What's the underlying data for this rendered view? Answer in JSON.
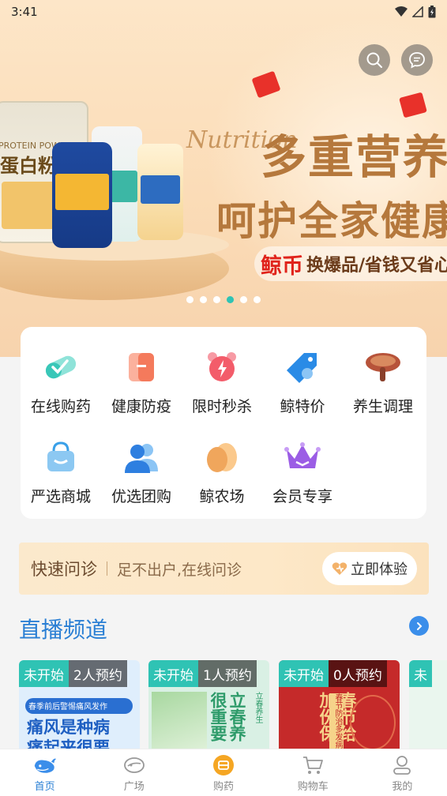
{
  "status_bar": {
    "time": "3:41"
  },
  "banner": {
    "script_text": "Nutrition",
    "headline1": "多重营养",
    "headline2": "呵护全家健康",
    "tag_coin": "鲸币",
    "tag_text": "换爆品/省钱又省心",
    "product_label": "蛋白粉",
    "product_label_small": "PROTEIN POWDER",
    "dots_total": 6,
    "dots_active_index": 3
  },
  "menu": {
    "row1": [
      {
        "label": "在线购药",
        "icon": "pill-icon",
        "color": "#39c7b8"
      },
      {
        "label": "健康防疫",
        "icon": "medical-kit-icon",
        "color": "#f47a5c"
      },
      {
        "label": "限时秒杀",
        "icon": "alarm-clock-icon",
        "color": "#f35c6a"
      },
      {
        "label": "鲸特价",
        "icon": "price-tag-icon",
        "color": "#2a8be6"
      },
      {
        "label": "养生调理",
        "icon": "lingzhi-mushroom-icon",
        "color": "#b7533a"
      }
    ],
    "row2": [
      {
        "label": "严选商城",
        "icon": "shopping-bag-icon",
        "color": "#3aa0e8"
      },
      {
        "label": "优选团购",
        "icon": "group-users-icon",
        "color": "#2e7fe0"
      },
      {
        "label": "鲸农场",
        "icon": "egg-icon",
        "color": "#f0a65c"
      },
      {
        "label": "会员专享",
        "icon": "crown-icon",
        "color": "#9b5de5"
      }
    ]
  },
  "consult": {
    "title": "快速问诊",
    "subtitle": "足不出户,在线问诊",
    "button": "立即体验"
  },
  "live": {
    "title": "直播频道",
    "cards": [
      {
        "status": "未开始",
        "reserve": "2人预约",
        "caption_top": "春季前后警惕痛风发作",
        "caption_main": "痛风是种病 痛起来很要命",
        "bg": "#dfeefc"
      },
      {
        "status": "未开始",
        "reserve": "1人预约",
        "caption_top": "立春养生",
        "caption_main": "立春养 很重要",
        "bg": "#d9f0e4"
      },
      {
        "status": "未开始",
        "reserve": "0人预约",
        "caption_top": "春节防治多发病",
        "caption_main": "春节给 加份保",
        "bg": "#c52a2a"
      },
      {
        "status": "未",
        "reserve": "",
        "caption_top": "",
        "caption_main": "",
        "bg": "#eaf6ee"
      }
    ]
  },
  "nav": [
    {
      "label": "首页",
      "icon": "whale-home-icon",
      "active": true
    },
    {
      "label": "广场",
      "icon": "square-plaza-icon",
      "active": false
    },
    {
      "label": "购药",
      "icon": "buy-medicine-icon",
      "active": false
    },
    {
      "label": "购物车",
      "icon": "cart-icon",
      "active": false
    },
    {
      "label": "我的",
      "icon": "profile-icon",
      "active": false
    }
  ],
  "colors": {
    "accent_teal": "#2fc3b4",
    "accent_blue": "#2a7fd4",
    "banner_gold": "#b5783c",
    "coin_red": "#e0231b"
  }
}
